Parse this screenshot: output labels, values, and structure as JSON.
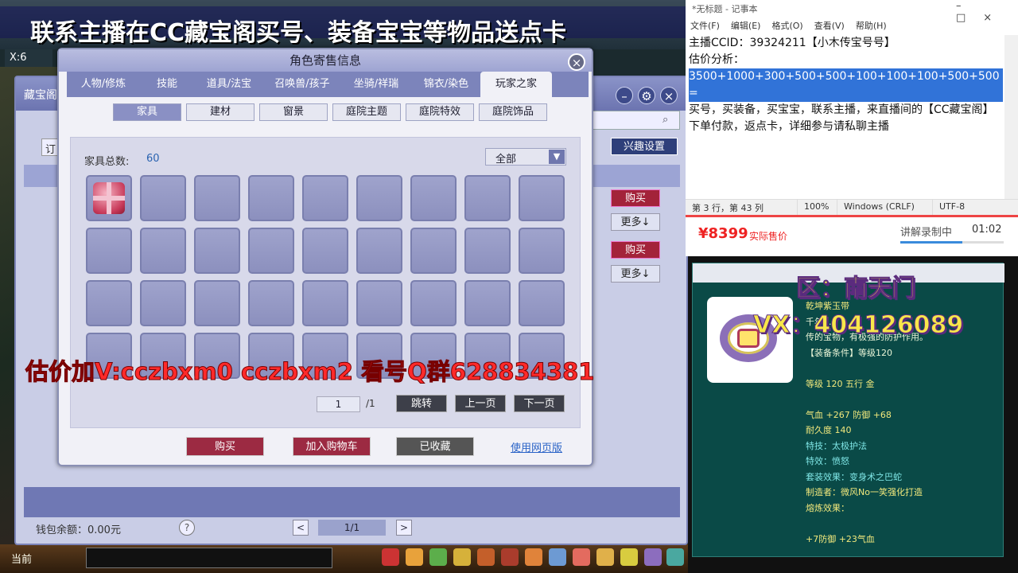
{
  "banner": "联系主播在CC藏宝阁买号、装备宝宝等物品送点卡",
  "overlay_red": "估价加V:cczbxm0    cczbxm2   看号Q群628834381",
  "game": {
    "coords": "X:6",
    "chat_channel": "当前"
  },
  "treasure": {
    "title": "藏宝阁",
    "filter_label": "订",
    "interest_button": "兴趣设置",
    "rows": [
      {
        "buy": "购买",
        "more": "更多↓"
      },
      {
        "buy": "购买",
        "more": "更多↓"
      }
    ],
    "wallet": "钱包余额：0.00元",
    "help": "?",
    "pager": {
      "prev": "<",
      "current": "1/1",
      "next": ">"
    }
  },
  "dialog": {
    "title": "角色寄售信息",
    "close": "×",
    "tabs": [
      "人物/修炼",
      "技能",
      "道具/法宝",
      "召唤兽/孩子",
      "坐骑/祥瑞",
      "锦衣/染色",
      "玩家之家"
    ],
    "active_tab": 6,
    "subtabs": [
      "家具",
      "建材",
      "窗景",
      "庭院主题",
      "庭院特效",
      "庭院饰品"
    ],
    "active_subtab": 0,
    "total_label": "家具总数:",
    "total_value": "60",
    "filter_value": "全部",
    "page_input": "1",
    "page_total": "/1",
    "jump": "跳转",
    "prev": "上一页",
    "next": "下一页",
    "buy": "购买",
    "add_cart": "加入购物车",
    "favorited": "已收藏",
    "web_link": "使用网页版"
  },
  "notepad": {
    "title": "*无标题 - 记事本",
    "menu": [
      "文件(F)",
      "编辑(E)",
      "格式(O)",
      "查看(V)",
      "帮助(H)"
    ],
    "line1": "主播CCID：39324211【小木传宝号号】",
    "line2": "估价分析：",
    "line3": "3500+1000+300+500+500+100+100+100+500+500=",
    "line4": "买号，买装备，买宝宝，联系主播，来直播间的【CC藏宝阁】下单付款，返点卡，详细参与请私聊主播",
    "status": [
      "第 3 行，第 43 列",
      "100%",
      "Windows (CRLF)",
      "UTF-8"
    ]
  },
  "price": {
    "value": "¥8399",
    "label": "实际售价",
    "recording": "讲解录制中",
    "time": "01:02",
    "progress": 0.6
  },
  "item": {
    "name": "乾坤紫玉带",
    "desc1": "千年...",
    "desc2": "传的宝物，有极强的防护作用。",
    "req": "【装备条件】等级120",
    "level": "等级 120  五行 金",
    "attr": "气血 +267 防御 +68",
    "durability": "耐久度 140",
    "skill": "特技：太极护法",
    "effect": "特效：愤怒",
    "set": "套装效果：变身术之巴蛇",
    "maker": "制造者：微风No一笑强化打造",
    "refine": "熔炼效果：",
    "refine_val": "+7防御 +23气血",
    "overlay_zone": "区：南天门",
    "overlay_vx": "VX：404126089"
  },
  "colors": {
    "accent_red": "#a3233a",
    "price_red": "#e22222",
    "panel_bg": "#0a4a47"
  }
}
